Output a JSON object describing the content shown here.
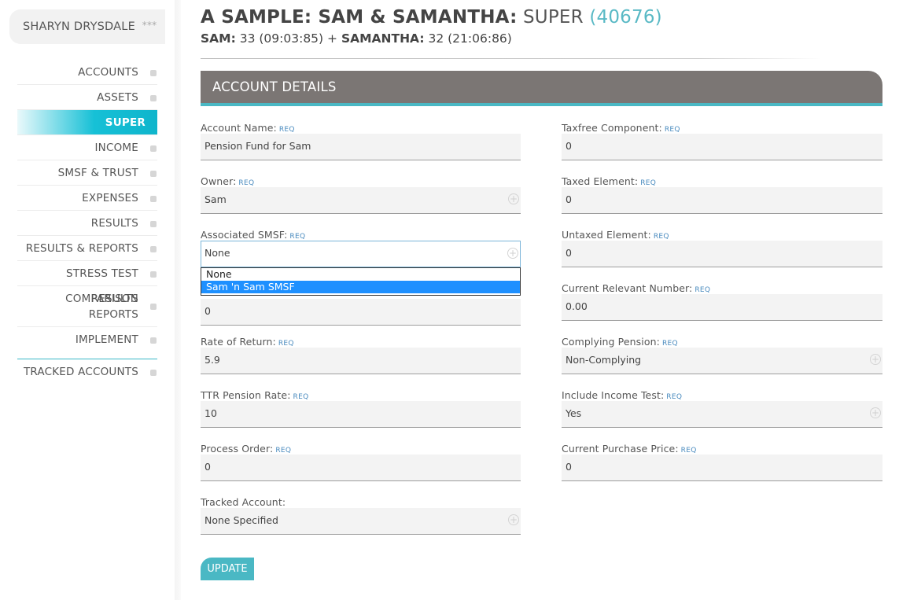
{
  "user": {
    "name": "SHARYN DRYSDALE",
    "stars": "***"
  },
  "nav": {
    "items": [
      {
        "label": "ACCOUNTS"
      },
      {
        "label": "ASSETS"
      },
      {
        "label": "SUPER"
      },
      {
        "label": "INCOME"
      },
      {
        "label": "SMSF & TRUST"
      },
      {
        "label": "EXPENSES"
      },
      {
        "label": "RESULTS"
      },
      {
        "label": "RESULTS & REPORTS"
      },
      {
        "label": "STRESS TEST RESULTS"
      },
      {
        "label": "COMPARISON REPORTS"
      },
      {
        "label": "IMPLEMENT"
      }
    ],
    "tracked": "TRACKED ACCOUNTS"
  },
  "header": {
    "title_main": "A SAMPLE: SAM & SAMANTHA:",
    "title_section": "SUPER",
    "title_code": "(40676)",
    "person1_name": "SAM:",
    "person1_info": "33 (09:03:85) +",
    "person2_name": "SAMANTHA:",
    "person2_info": "32 (21:06:86)"
  },
  "panel": {
    "title": "ACCOUNT DETAILS"
  },
  "req": "REQ",
  "left_fields": [
    {
      "label": "Account Name:",
      "value": "Pension Fund for Sam"
    },
    {
      "label": "Owner:",
      "value": "Sam"
    },
    {
      "label": "Associated SMSF:",
      "value": "None"
    },
    {
      "label": "",
      "value": "0"
    },
    {
      "label": "Rate of Return:",
      "value": "5.9"
    },
    {
      "label": "TTR Pension Rate:",
      "value": "10"
    },
    {
      "label": "Process Order:",
      "value": "0"
    },
    {
      "label": "Tracked Account:",
      "value": "None Specified"
    }
  ],
  "right_fields": [
    {
      "label": "Taxfree Component:",
      "value": "0"
    },
    {
      "label": "Taxed Element:",
      "value": "0"
    },
    {
      "label": "Untaxed Element:",
      "value": "0"
    },
    {
      "label": "Current Relevant Number:",
      "value": "0.00"
    },
    {
      "label": "Complying Pension:",
      "value": "Non-Complying"
    },
    {
      "label": "Include Income Test:",
      "value": "Yes"
    },
    {
      "label": "Current Purchase Price:",
      "value": "0"
    }
  ],
  "smsf_dropdown": {
    "options": [
      "None",
      "Sam 'n Sam SMSF"
    ],
    "highlighted": "Sam 'n Sam SMSF"
  },
  "update_label": "UPDATE",
  "icons": {
    "select_plus": "plus-circle-icon",
    "nav_marker": "square-icon"
  },
  "colors": {
    "accent": "#4ab8c4",
    "active_nav": "#16c0d6",
    "panel_head": "#7b7674",
    "req_link": "#4a8bbf"
  }
}
